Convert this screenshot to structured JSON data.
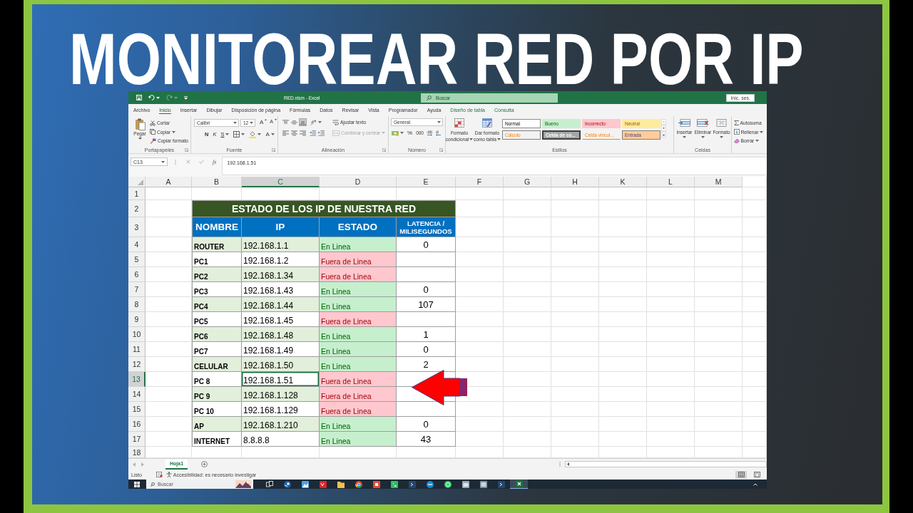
{
  "headline": "MONITOREAR RED POR IP",
  "excel": {
    "title_bar": {
      "quick_access": [
        {
          "disabled": false
        },
        {
          "disabled": false
        },
        {
          "disabled": true
        }
      ],
      "title": "RED.xlsm - Excel",
      "search": {
        "placeholder": "Buscar"
      },
      "sign_in": "Inic. ses."
    },
    "tabs": [
      {
        "label": "Archivo",
        "kind": "standard",
        "selected": false
      },
      {
        "label": "Inicio",
        "kind": "standard",
        "selected": true
      },
      {
        "label": "Insertar",
        "kind": "standard",
        "selected": false
      },
      {
        "label": "Dibujar",
        "kind": "standard",
        "selected": false
      },
      {
        "label": "Disposición de página",
        "kind": "standard",
        "selected": false
      },
      {
        "label": "Fórmulas",
        "kind": "standard",
        "selected": false
      },
      {
        "label": "Datos",
        "kind": "standard",
        "selected": false
      },
      {
        "label": "Revisar",
        "kind": "standard",
        "selected": false
      },
      {
        "label": "Vista",
        "kind": "standard",
        "selected": false
      },
      {
        "label": "Programador",
        "kind": "standard",
        "selected": false
      },
      {
        "label": "Ayuda",
        "kind": "standard",
        "selected": false
      },
      {
        "label": "Diseño de tabla",
        "kind": "contextual",
        "selected": false
      },
      {
        "label": "Consulta",
        "kind": "contextual",
        "selected": false
      }
    ],
    "ribbon": {
      "clipboard": {
        "paste": "Pegar",
        "cut": "Cortar",
        "copy": "Copiar",
        "format_painter": "Copiar formato",
        "label": "Portapapeles"
      },
      "font": {
        "font_name": "Calibri",
        "font_size": "12",
        "grow": "A",
        "shrink": "A",
        "bold": "N",
        "italic": "K",
        "underline": "S",
        "font_color": "A",
        "label": "Fuente"
      },
      "alignment": {
        "vertical": [
          {
            "selected": false
          },
          {
            "selected": false
          },
          {
            "selected": true
          }
        ],
        "wrap_text": "Ajustar texto",
        "horizontal": [
          {
            "selected": false
          },
          {
            "selected": false
          },
          {
            "selected": false
          }
        ],
        "merge": {
          "label": "Combinar y centrar",
          "disabled": true
        },
        "label": "Alineación"
      },
      "number": {
        "format": "General",
        "percent": "%",
        "thousands": "000",
        "label": "Número"
      },
      "styles": {
        "conditional_format": [
          "Formato",
          "condicional"
        ],
        "format_as_table": [
          "Dar formato",
          "como tabla"
        ],
        "cell_styles": [
          {
            "label": "Normal",
            "kind": "normal"
          },
          {
            "label": "Bueno",
            "kind": "good"
          },
          {
            "label": "Incorrecto",
            "kind": "bad"
          },
          {
            "label": "Neutral",
            "kind": "neutral"
          },
          {
            "label": "Cálculo",
            "kind": "calculation"
          },
          {
            "label": "Celda de co...",
            "kind": "check"
          },
          {
            "label": "Celda vincul...",
            "kind": "linked"
          },
          {
            "label": "Entrada",
            "kind": "input"
          }
        ],
        "label": "Estilos"
      },
      "cells": {
        "insert": "Insertar",
        "delete": "Eliminar",
        "format": "Formato",
        "label": "Celdas"
      },
      "editing": {
        "autosum": "Autosuma",
        "fill": "Rellenar",
        "clear": "Borrar"
      }
    },
    "formula_bar": {
      "name_box": "C13",
      "function_symbol": "fx",
      "value": "192.168.1.51"
    },
    "sheet": {
      "columns": [
        {
          "label": "A",
          "selected": false
        },
        {
          "label": "B",
          "selected": false
        },
        {
          "label": "C",
          "selected": true
        },
        {
          "label": "D",
          "selected": false
        },
        {
          "label": "E",
          "selected": false
        },
        {
          "label": "F",
          "selected": false
        },
        {
          "label": "G",
          "selected": false
        },
        {
          "label": "H",
          "selected": false
        },
        {
          "label": "K",
          "selected": false
        },
        {
          "label": "L",
          "selected": false
        },
        {
          "label": "M",
          "selected": false
        }
      ],
      "rows": [
        {
          "label": "1",
          "selected": false
        },
        {
          "label": "2",
          "selected": false
        },
        {
          "label": "3",
          "selected": false
        },
        {
          "label": "4",
          "selected": false
        },
        {
          "label": "5",
          "selected": false
        },
        {
          "label": "6",
          "selected": false
        },
        {
          "label": "7",
          "selected": false
        },
        {
          "label": "8",
          "selected": false
        },
        {
          "label": "9",
          "selected": false
        },
        {
          "label": "10",
          "selected": false
        },
        {
          "label": "11",
          "selected": false
        },
        {
          "label": "12",
          "selected": false
        },
        {
          "label": "13",
          "selected": true
        },
        {
          "label": "14",
          "selected": false
        },
        {
          "label": "15",
          "selected": false
        },
        {
          "label": "16",
          "selected": false
        },
        {
          "label": "17",
          "selected": false
        },
        {
          "label": "18",
          "selected": false
        }
      ],
      "table": {
        "title": "ESTADO DE LOS IP DE NUESTRA RED",
        "headers": [
          "NOMBRE",
          "IP",
          "ESTADO",
          "LATENCIA / MILISEGUNDOS"
        ],
        "rows": [
          {
            "name": "ROUTER",
            "ip": "192.168.1.1",
            "status": "En Linea",
            "online": true,
            "latency": "0"
          },
          {
            "name": "PC1",
            "ip": "192.168.1.2",
            "status": "Fuera de Linea",
            "online": false
          },
          {
            "name": "PC2",
            "ip": "192.168.1.34",
            "status": "Fuera de Linea",
            "online": false
          },
          {
            "name": "PC3",
            "ip": "192.168.1.43",
            "status": "En Linea",
            "online": true,
            "latency": "0"
          },
          {
            "name": "PC4",
            "ip": "192.168.1.44",
            "status": "En Linea",
            "online": true,
            "latency": "107"
          },
          {
            "name": "PC5",
            "ip": "192.168.1.45",
            "status": "Fuera de Linea",
            "online": false
          },
          {
            "name": "PC6",
            "ip": "192.168.1.48",
            "status": "En Linea",
            "online": true,
            "latency": "1"
          },
          {
            "name": "PC7",
            "ip": "192.168.1.49",
            "status": "En Linea",
            "online": true,
            "latency": "0"
          },
          {
            "name": "CELULAR",
            "ip": "192.168.1.50",
            "status": "En Linea",
            "online": true,
            "latency": "2"
          },
          {
            "name": "PC 8",
            "ip": "192.168.1.51",
            "status": "Fuera de Linea",
            "online": false
          },
          {
            "name": "PC 9",
            "ip": "192.168.1.128",
            "status": "Fuera de Linea",
            "online": false
          },
          {
            "name": "PC 10",
            "ip": "192.168.1.129",
            "status": "Fuera de Linea",
            "online": false
          },
          {
            "name": "AP",
            "ip": "192.168.1.210",
            "status": "En Linea",
            "online": true,
            "latency": "0"
          },
          {
            "name": "INTERNET",
            "ip": "8.8.8.8",
            "status": "En Linea",
            "online": true,
            "latency": "43"
          }
        ]
      }
    },
    "sheet_tabs": [
      {
        "label": "Hoja1",
        "selected": true
      }
    ],
    "status_bar": {
      "status": "Listo",
      "accessibility": "Accesibilidad: es necesario investigar",
      "views": [
        {
          "selected": true
        },
        {
          "selected": false
        }
      ]
    },
    "taskbar": {
      "search": {
        "placeholder": "Buscar"
      },
      "apps": [
        {
          "selected": false
        },
        {
          "selected": false
        },
        {
          "selected": false
        },
        {
          "selected": false
        },
        {
          "selected": false
        },
        {
          "selected": false
        },
        {
          "selected": false
        },
        {
          "selected": false
        },
        {
          "selected": false
        },
        {
          "selected": false
        },
        {
          "selected": false
        },
        {
          "selected": false
        },
        {
          "selected": false
        },
        {
          "selected": false
        },
        {
          "selected": true
        }
      ]
    }
  }
}
